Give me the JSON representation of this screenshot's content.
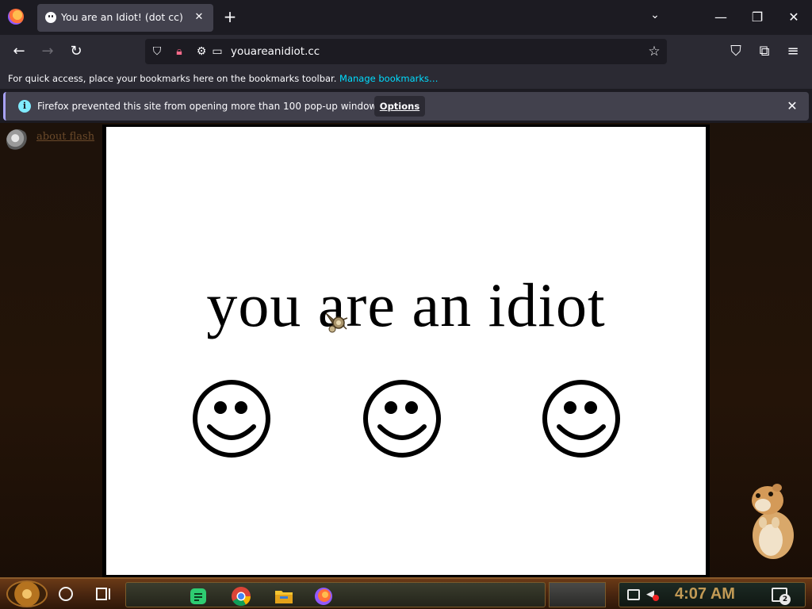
{
  "browser": {
    "tab_title": "You are an Idiot! (dot cc)",
    "url": "youareanidiot.cc",
    "bookmarks_hint": "For quick access, place your bookmarks here on the bookmarks toolbar.",
    "bookmarks_link": "Manage bookmarks…"
  },
  "notification": {
    "message": "Firefox prevented this site from opening more than 100 pop-up windows.",
    "options_label": "Options"
  },
  "page": {
    "flash_link": "about flash",
    "headline": "you are an idiot"
  },
  "taskbar": {
    "clock": "4:07 AM",
    "notification_count": "2"
  },
  "colors": {
    "accent_link": "#00ddff",
    "notice_border": "#a8a2f6",
    "clock": "#c29a55"
  }
}
